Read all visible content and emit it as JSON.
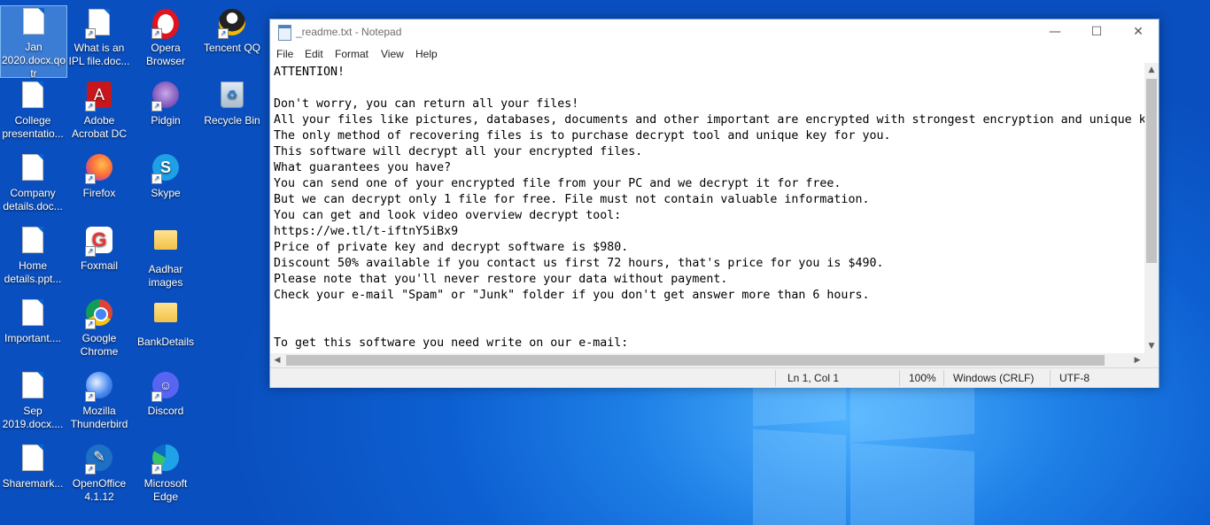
{
  "desktop_icons": [
    {
      "label": "Jan 2020.docx.qo tr"
    },
    {
      "label": "College presentatio..."
    },
    {
      "label": "Company details.doc..."
    },
    {
      "label": "Home details.ppt..."
    },
    {
      "label": "Important...."
    },
    {
      "label": "Sep 2019.docx...."
    },
    {
      "label": "Sharemark..."
    },
    {
      "label": "What is an IPL file.doc..."
    },
    {
      "label": "Adobe Acrobat DC"
    },
    {
      "label": "Firefox"
    },
    {
      "label": "Foxmail"
    },
    {
      "label": "Google Chrome"
    },
    {
      "label": "Mozilla Thunderbird"
    },
    {
      "label": "OpenOffice 4.1.12"
    },
    {
      "label": "Opera Browser"
    },
    {
      "label": "Pidgin"
    },
    {
      "label": "Skype"
    },
    {
      "label": "Aadhar images"
    },
    {
      "label": "BankDetails"
    },
    {
      "label": "Discord"
    },
    {
      "label": "Microsoft Edge"
    },
    {
      "label": "Tencent QQ"
    },
    {
      "label": "Recycle Bin"
    }
  ],
  "notepad": {
    "title": "_readme.txt - Notepad",
    "controls": {
      "minimize": "—",
      "maximize": "☐",
      "close": "✕"
    },
    "menu": [
      "File",
      "Edit",
      "Format",
      "View",
      "Help"
    ],
    "text": "ATTENTION!\n\nDon't worry, you can return all your files!\nAll your files like pictures, databases, documents and other important are encrypted with strongest encryption and unique k\nThe only method of recovering files is to purchase decrypt tool and unique key for you.\nThis software will decrypt all your encrypted files.\nWhat guarantees you have?\nYou can send one of your encrypted file from your PC and we decrypt it for free.\nBut we can decrypt only 1 file for free. File must not contain valuable information.\nYou can get and look video overview decrypt tool:\nhttps://we.tl/t-iftnY5iBx9\nPrice of private key and decrypt software is $980.\nDiscount 50% available if you contact us first 72 hours, that's price for you is $490.\nPlease note that you'll never restore your data without payment.\nCheck your e-mail \"Spam\" or \"Junk\" folder if you don't get answer more than 6 hours.\n\n\nTo get this software you need write on our e-mail:",
    "status": {
      "position": "Ln 1, Col 1",
      "zoom": "100%",
      "line_ending": "Windows (CRLF)",
      "encoding": "UTF-8"
    }
  }
}
